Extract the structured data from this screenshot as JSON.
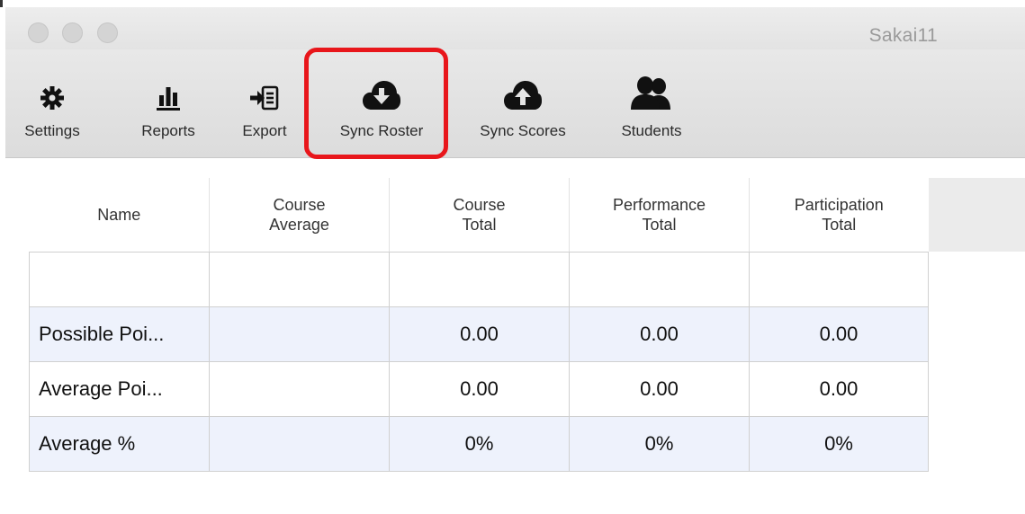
{
  "window": {
    "title": "Sakai11"
  },
  "toolbar": {
    "items": [
      {
        "label": "Settings",
        "icon": "gear-icon"
      },
      {
        "label": "Reports",
        "icon": "bar-chart-icon"
      },
      {
        "label": "Export",
        "icon": "export-icon"
      },
      {
        "label": "Sync Roster",
        "icon": "cloud-download-icon",
        "highlighted": true
      },
      {
        "label": "Sync Scores",
        "icon": "cloud-upload-icon"
      },
      {
        "label": "Students",
        "icon": "users-icon"
      }
    ],
    "highlight_color": "#e8161b"
  },
  "table": {
    "columns": [
      {
        "line1": "Name",
        "line2": ""
      },
      {
        "line1": "Course",
        "line2": "Average"
      },
      {
        "line1": "Course",
        "line2": "Total"
      },
      {
        "line1": "Performance",
        "line2": "Total"
      },
      {
        "line1": "Participation",
        "line2": "Total"
      }
    ],
    "rows": [
      [
        "",
        "",
        "",
        "",
        ""
      ],
      [
        "Possible Poi...",
        "",
        "0.00",
        "0.00",
        "0.00"
      ],
      [
        "Average Poi...",
        "",
        "0.00",
        "0.00",
        "0.00"
      ],
      [
        "Average %",
        "",
        "0%",
        "0%",
        "0%"
      ]
    ],
    "alt_row_color": "#eef2fc"
  }
}
